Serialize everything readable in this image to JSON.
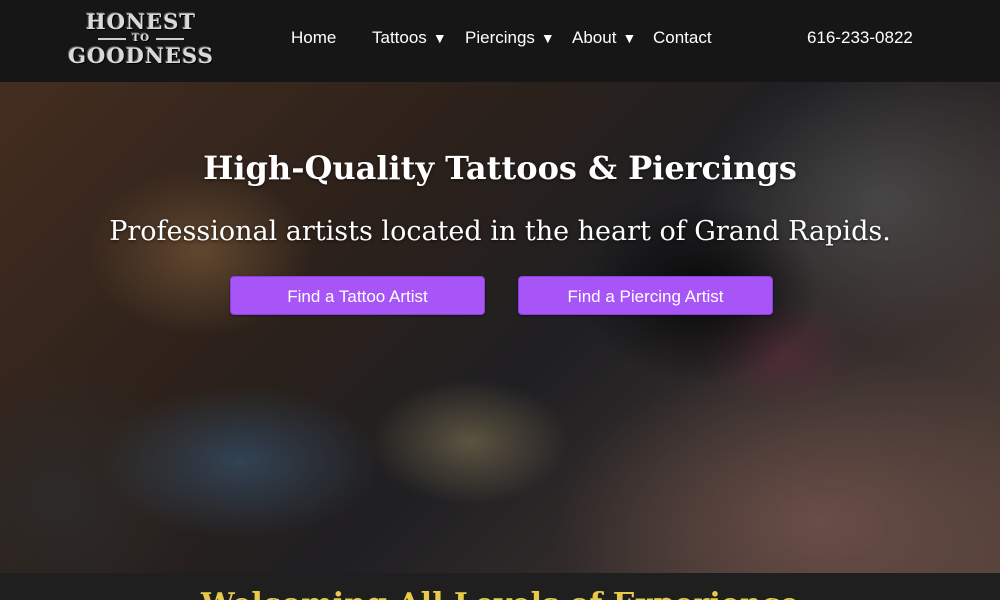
{
  "logo": {
    "line1": "HONEST",
    "line2": "TO",
    "line3": "GOODNESS"
  },
  "nav": {
    "items": [
      {
        "label": "Home",
        "dropdown": false
      },
      {
        "label": "Tattoos",
        "dropdown": true
      },
      {
        "label": "Piercings",
        "dropdown": true
      },
      {
        "label": "About",
        "dropdown": true
      },
      {
        "label": "Contact",
        "dropdown": false
      }
    ],
    "caret": "▼",
    "phone": "616-233-0822"
  },
  "hero": {
    "title": "High-Quality Tattoos & Piercings",
    "subtitle": "Professional artists located in the heart of Grand Rapids.",
    "buttons": {
      "tattoo": "Find a Tattoo Artist",
      "piercing": "Find a Piercing Artist"
    }
  },
  "welcome": {
    "heading": "Welcoming All Levels of Experience"
  },
  "colors": {
    "accent": "#a855f7",
    "header_bg": "#161616",
    "welcome_text": "#e8c94a"
  }
}
